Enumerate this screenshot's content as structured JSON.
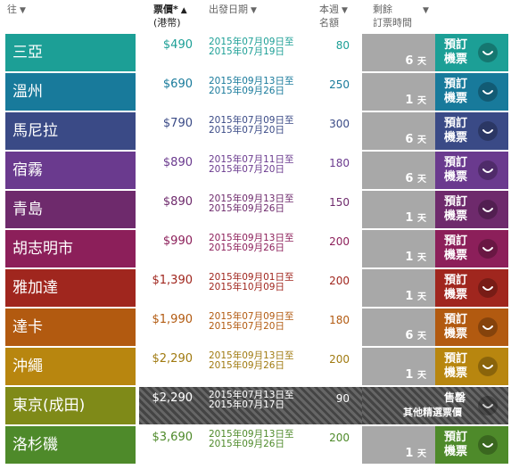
{
  "header": {
    "destination": "往",
    "fare_line1": "票價*",
    "fare_line2": "(港幣)",
    "dates": "出發日期",
    "quota_line1": "本週",
    "quota_line2": "名額",
    "remaining_line1": "剩餘",
    "remaining_line2": "訂票時間"
  },
  "icons": {
    "sort_down": "▼",
    "sort_up": "▲"
  },
  "rows": [
    {
      "dest": "三亞",
      "price": "$490",
      "date_from": "2015年07月09日至",
      "date_to": "2015年07月19日",
      "quota": "80",
      "days": "6",
      "days_unit": "天",
      "book": "預訂機票",
      "color": "#1c9f96",
      "text_color": "#1c9f96"
    },
    {
      "dest": "溫州",
      "price": "$690",
      "date_from": "2015年09月13日至",
      "date_to": "2015年09月26日",
      "quota": "250",
      "days": "1",
      "days_unit": "天",
      "book": "預訂機票",
      "color": "#187a9b",
      "text_color": "#187a9b"
    },
    {
      "dest": "馬尼拉",
      "price": "$790",
      "date_from": "2015年07月09日至",
      "date_to": "2015年07月20日",
      "quota": "300",
      "days": "6",
      "days_unit": "天",
      "book": "預訂機票",
      "color": "#3a4a86",
      "text_color": "#3a4a86"
    },
    {
      "dest": "宿霧",
      "price": "$890",
      "date_from": "2015年07月11日至",
      "date_to": "2015年07月20日",
      "quota": "180",
      "days": "6",
      "days_unit": "天",
      "book": "預訂機票",
      "color": "#6a3a8e",
      "text_color": "#6a3a8e"
    },
    {
      "dest": "青島",
      "price": "$890",
      "date_from": "2015年09月13日至",
      "date_to": "2015年09月26日",
      "quota": "150",
      "days": "1",
      "days_unit": "天",
      "book": "預訂機票",
      "color": "#6e2a6c",
      "text_color": "#6e2a6c"
    },
    {
      "dest": "胡志明市",
      "price": "$990",
      "date_from": "2015年09月13日至",
      "date_to": "2015年09月26日",
      "quota": "200",
      "days": "1",
      "days_unit": "天",
      "book": "預訂機票",
      "color": "#8c1f5a",
      "text_color": "#8c1f5a"
    },
    {
      "dest": "雅加達",
      "price": "$1,390",
      "date_from": "2015年09月01日至",
      "date_to": "2015年10月09日",
      "quota": "200",
      "days": "1",
      "days_unit": "天",
      "book": "預訂機票",
      "color": "#a0261e",
      "text_color": "#a0261e"
    },
    {
      "dest": "達卡",
      "price": "$1,990",
      "date_from": "2015年07月09日至",
      "date_to": "2015年07月20日",
      "quota": "180",
      "days": "6",
      "days_unit": "天",
      "book": "預訂機票",
      "color": "#b25a10",
      "text_color": "#b25a10"
    },
    {
      "dest": "沖繩",
      "price": "$2,290",
      "date_from": "2015年09月13日至",
      "date_to": "2015年09月26日",
      "quota": "200",
      "days": "1",
      "days_unit": "天",
      "book": "預訂機票",
      "color": "#b8860f",
      "text_color": "#a07a10"
    },
    {
      "dest": "東京(成田)",
      "price": "$2,290",
      "date_from": "2015年07月13日至",
      "date_to": "2015年07月17日",
      "quota": "90",
      "soldout": true,
      "soldout_line1": "售罄",
      "soldout_line2": "其他精選票價",
      "color": "#7f8a18",
      "text_color": "#ffffff"
    },
    {
      "dest": "洛杉磯",
      "price": "$3,690",
      "date_from": "2015年09月13日至",
      "date_to": "2015年09月26日",
      "quota": "200",
      "days": "1",
      "days_unit": "天",
      "book": "預訂機票",
      "color": "#4e8a2a",
      "text_color": "#4e8a2a"
    }
  ]
}
